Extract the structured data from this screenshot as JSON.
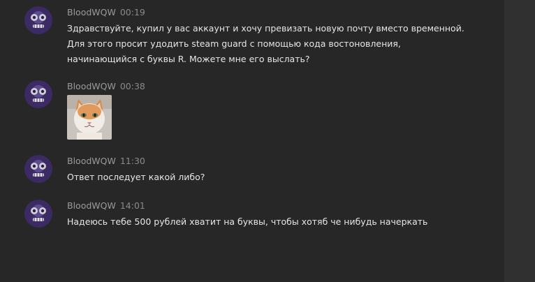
{
  "messages": [
    {
      "author": "BloodWQW",
      "time": "00:19",
      "lines": [
        "Здравствуйте, купил у вас аккаунт и хочу превизать новую почту вместо временной.",
        "Для этого просит удодить steam guard с помощью кода востоновления,",
        "начинающийся с буквы R. Можете мне его выслать?"
      ]
    },
    {
      "author": "BloodWQW",
      "time": "00:38",
      "attachment": "cat-photo"
    },
    {
      "author": "BloodWQW",
      "time": "11:30",
      "lines": [
        "Ответ последует какой либо?"
      ]
    },
    {
      "author": "BloodWQW",
      "time": "14:01",
      "lines": [
        "Надеюсь тебе 500 рублей хватит на буквы, чтобы хотяб че нибудь начеркать"
      ]
    }
  ],
  "colors": {
    "background": "#272727",
    "author": "#9a9a9a",
    "text": "#e6e6e6",
    "avatar": "#3b2a63"
  },
  "icons": {
    "avatar": "purple-minion-avatar-icon"
  }
}
